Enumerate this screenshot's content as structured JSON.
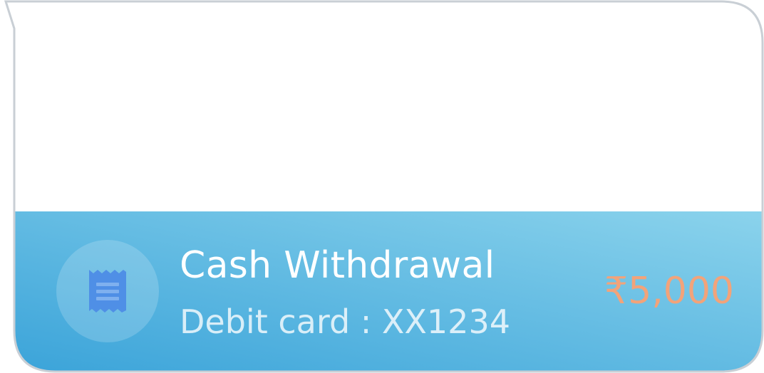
{
  "transaction": {
    "title": "Cash Withdrawal",
    "subtitle": "Debit card : XX1234",
    "amount": "₹5,000",
    "icon": "receipt-icon"
  },
  "colors": {
    "panel_gradient_start": "#3aa3d9",
    "panel_gradient_end": "#8bd3ec",
    "amount": "#f2a37a",
    "icon": "#4f8fe6",
    "border": "#c9cfd5"
  }
}
